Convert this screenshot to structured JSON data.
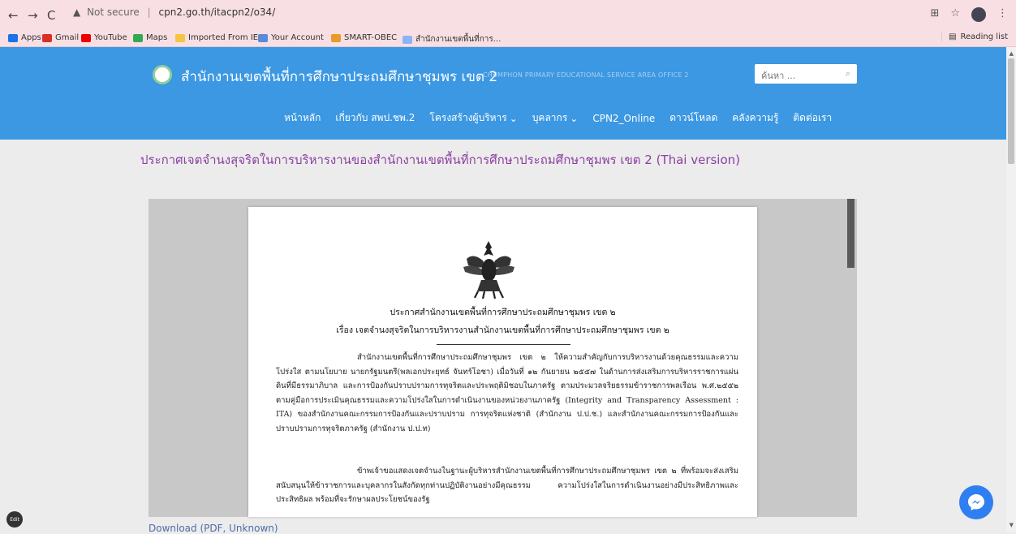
{
  "browser": {
    "security_label": "Not secure",
    "url": "cpn2.go.th/itacpn2/o34/",
    "bookmarks": [
      {
        "label": "Apps",
        "icon": "apps-grid-icon",
        "color": "#1a73e8"
      },
      {
        "label": "Gmail",
        "icon": "gmail-icon",
        "color": "#d93025"
      },
      {
        "label": "YouTube",
        "icon": "youtube-icon",
        "color": "#e00"
      },
      {
        "label": "Maps",
        "icon": "maps-icon",
        "color": "#34a853"
      },
      {
        "label": "Imported From IE",
        "icon": "folder-icon",
        "color": "#f4c542"
      },
      {
        "label": "Your Account",
        "icon": "account-icon",
        "color": "#5b8bd9"
      },
      {
        "label": "SMART-OBEC",
        "icon": "smart-obec-icon",
        "color": "#e89a2a"
      },
      {
        "label": "สำนักงานเขตพื้นที่การ...",
        "icon": "site-icon",
        "color": "#8ab4f8"
      }
    ],
    "reading_list": "Reading list"
  },
  "site": {
    "title": "สำนักงานเขตพื้นที่การศึกษาประถมศึกษาชุมพร เขต 2",
    "subtitle": "CHUMPHON PRIMARY EDUCATIONAL SERVICE AREA OFFICE 2",
    "search_placeholder": "ค้นหา ...",
    "menu": [
      {
        "label": "หน้าหลัก",
        "dropdown": false
      },
      {
        "label": "เกี่ยวกับ สพป.ชพ.2",
        "dropdown": false
      },
      {
        "label": "โครงสร้างผู้บริหาร",
        "dropdown": true
      },
      {
        "label": "บุคลากร",
        "dropdown": true
      },
      {
        "label": "CPN2_Online",
        "dropdown": false
      },
      {
        "label": "ดาวน์โหลด",
        "dropdown": false
      },
      {
        "label": "คลังความรู้",
        "dropdown": false
      },
      {
        "label": "ติดต่อเรา",
        "dropdown": false
      }
    ]
  },
  "page": {
    "title": "ประกาศเจตจำนงสุจริตในการบริหารงานของสำนักงานเขตพื้นที่การศึกษาประถมศึกษาชุมพร เขต 2 (Thai version)",
    "download_link": "Download (PDF, Unknown)"
  },
  "document": {
    "heading_1": "ประกาศสำนักงานเขตพื้นที่การศึกษาประถมศึกษาชุมพร เขต ๒",
    "heading_2": "เรื่อง  เจตจำนงสุจริตในการบริหารงานสำนักงานเขตพื้นที่การศึกษาประถมศึกษาชุมพร เขต ๒",
    "paragraph_1": "สำนักงานเขตพื้นที่การศึกษาประถมศึกษาชุมพร เขต ๒ ให้ความสำคัญกับการบริหารงานด้วยคุณธรรมและความโปร่งใส ตามนโยบาย นายกรัฐมนตรี(พลเอกประยุทธ์ จันทร์โอชา) เมื่อวันที่ ๑๒ กันยายน ๒๕๕๗ ในด้านการส่งเสริมการบริหารราชการแผ่นดินที่มีธรรมาภิบาล และการป้องกันปราบปรามการทุจริตและประพฤติมิชอบในภาครัฐ ตามประมวลจริยธรรมข้าราชการพลเรือน พ.ศ.๒๕๕๒ ตามคู่มือการประเมินคุณธรรมและความโปร่งใสในการดำเนินงานของหน่วยงานภาครัฐ (Integrity and Transparency Assessment : ITA) ของสำนักงานคณะกรรมการป้องกันและปราบปราม การทุจริตแห่งชาติ (สำนักงาน ป.ป.ช.) และสำนักงานคณะกรรมการป้องกันและปราบปรามการทุจริตภาครัฐ (สำนักงาน ป.ป.ท)",
    "paragraph_2": "ข้าพเจ้าขอแสดงเจตจำนงในฐานะผู้บริหารสำนักงานเขตพื้นที่การศึกษาประถมศึกษาชุมพร เขต ๒ ที่พร้อมจะส่งเสริมสนับสนุนให้ข้าราชการและบุคลากรในสังกัดทุกท่านปฏิบัติงานอย่างมีคุณธรรม ความโปร่งใสในการดำเนินงานอย่างมีประสิทธิภาพและประสิทธิผล พร้อมที่จะรักษาผลประโยชน์ของรัฐ"
  },
  "widgets": {
    "edit_label": "Edit",
    "messenger_icon": "messenger-icon"
  }
}
